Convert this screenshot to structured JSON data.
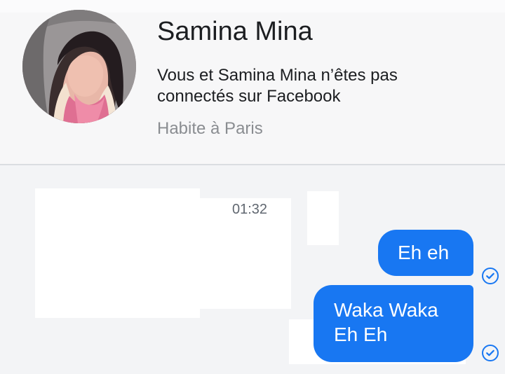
{
  "profile": {
    "name": "Samina Mina",
    "connection_status": "Vous et Samina Mina n’êtes pas connectés sur Facebook",
    "location": "Habite à Paris",
    "avatar_icon": "profile-photo"
  },
  "chat": {
    "timestamp": "01:32",
    "messages": [
      {
        "lines": [
          "Eh eh"
        ],
        "status_icon": "check-circle-icon"
      },
      {
        "lines": [
          "Waka Waka",
          "Eh Eh"
        ],
        "status_icon": "check-circle-icon"
      }
    ]
  },
  "colors": {
    "message_bubble": "#1877f2",
    "name_text": "#1c1e21",
    "secondary_text": "#8a8d91",
    "background": "#f2f3f5"
  }
}
